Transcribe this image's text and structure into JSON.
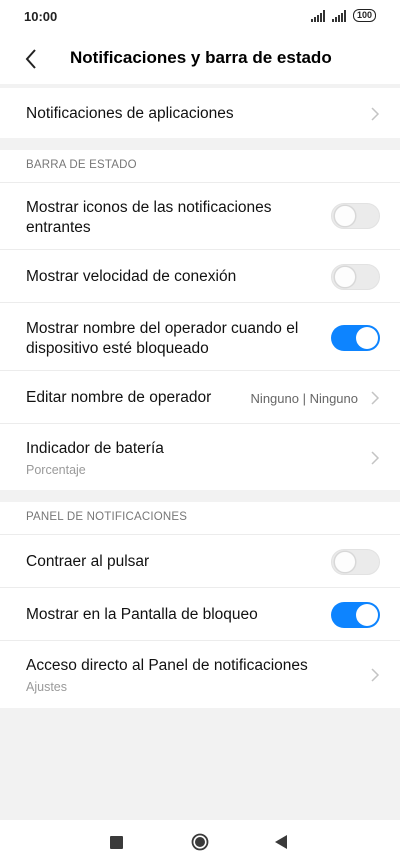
{
  "status_bar": {
    "time": "10:00",
    "battery": "100",
    "icons": [
      "signal-icon",
      "signal-icon",
      "battery-icon"
    ]
  },
  "header": {
    "title": "Notificaciones y barra de estado",
    "back_icon": "back-arrow-icon"
  },
  "app_notifications": {
    "label": "Notificaciones de aplicaciones"
  },
  "status_bar_section": {
    "title": "BARRA DE ESTADO",
    "items": [
      {
        "label": "Mostrar iconos de las notificaciones entrantes",
        "toggle": false
      },
      {
        "label": "Mostrar velocidad de conexión",
        "toggle": false
      },
      {
        "label": "Mostrar nombre del operador cuando el dispositivo esté bloqueado",
        "toggle": true
      },
      {
        "label": "Editar nombre de operador",
        "value": "Ninguno | Ninguno"
      },
      {
        "label": "Indicador de batería",
        "sub": "Porcentaje"
      }
    ]
  },
  "notification_panel_section": {
    "title": "PANEL DE NOTIFICACIONES",
    "items": [
      {
        "label": "Contraer al pulsar",
        "toggle": false
      },
      {
        "label": "Mostrar en la Pantalla de bloqueo",
        "toggle": true
      },
      {
        "label": "Acceso directo al Panel de notificaciones",
        "sub": "Ajustes"
      }
    ]
  },
  "colors": {
    "accent": "#0d84ff",
    "toggle_off": "#ebebeb",
    "background": "#f2f2f2"
  },
  "nav_bar": {
    "icons": [
      "recents-square-icon",
      "home-circle-icon",
      "back-triangle-icon"
    ]
  }
}
